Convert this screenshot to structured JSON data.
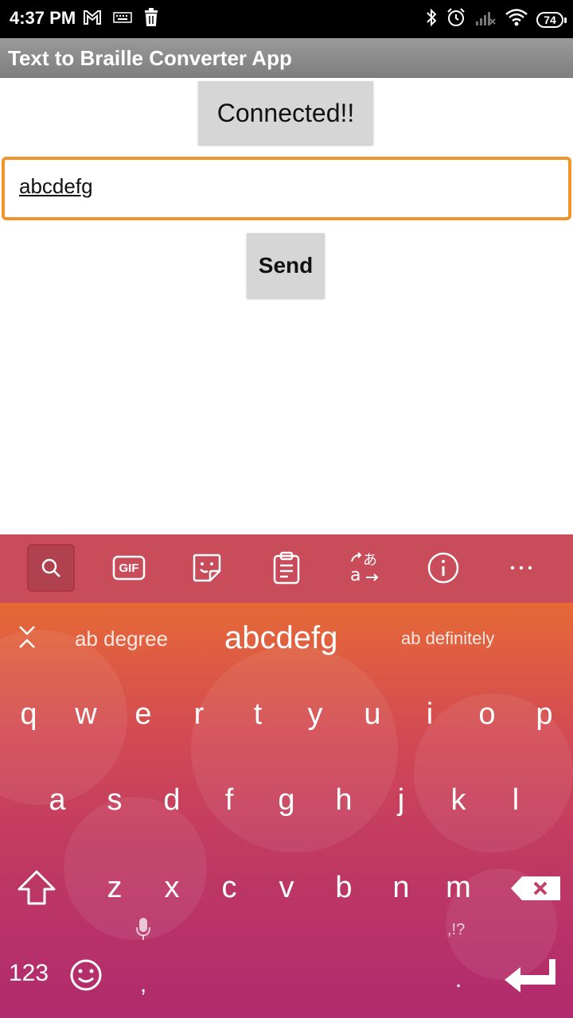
{
  "status_bar": {
    "time": "4:37 PM",
    "battery": "74"
  },
  "app": {
    "title": "Text to Braille Converter App"
  },
  "main": {
    "connection_status": "Connected!!",
    "text_input_value": "abcdefg",
    "send_label": "Send"
  },
  "keyboard": {
    "toolbar_icons": [
      "search-icon",
      "gif-icon",
      "sticker-icon",
      "clipboard-icon",
      "translate-icon",
      "info-icon",
      "more-icon"
    ],
    "gif_label": "GIF",
    "suggestions": {
      "left": "ab degree",
      "center": "abcdefg",
      "right": "ab definitely"
    },
    "row1": [
      "q",
      "w",
      "e",
      "r",
      "t",
      "y",
      "u",
      "i",
      "o",
      "p"
    ],
    "row2": [
      "a",
      "s",
      "d",
      "f",
      "g",
      "h",
      "j",
      "k",
      "l"
    ],
    "row3": [
      "z",
      "x",
      "c",
      "v",
      "b",
      "n",
      "m"
    ],
    "numbers_label": "123",
    "comma": ",",
    "period": ".",
    "punct_hint": ",!?"
  },
  "colors": {
    "accent_orange": "#f0942d",
    "keyboard_toolbar": "#c94c5a",
    "button_gray": "#d6d6d6"
  }
}
